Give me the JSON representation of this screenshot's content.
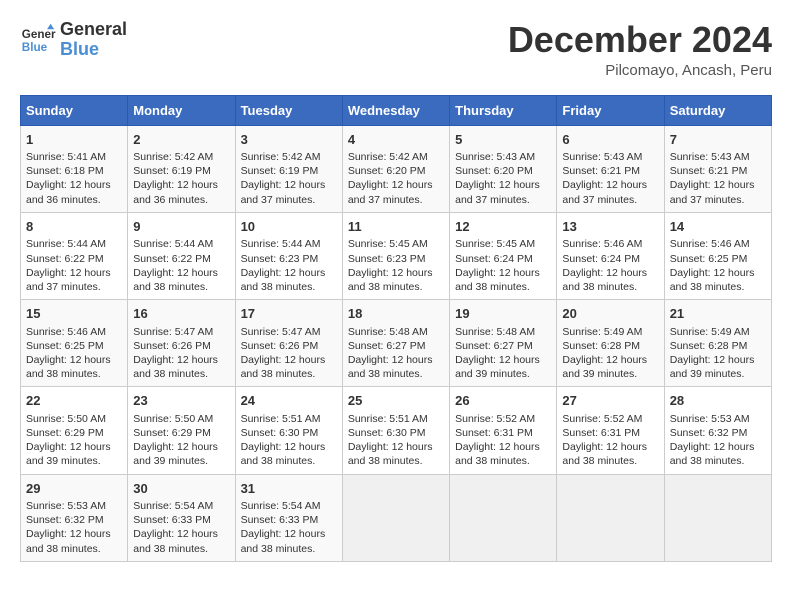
{
  "header": {
    "logo_line1": "General",
    "logo_line2": "Blue",
    "title": "December 2024",
    "subtitle": "Pilcomayo, Ancash, Peru"
  },
  "calendar": {
    "days_of_week": [
      "Sunday",
      "Monday",
      "Tuesday",
      "Wednesday",
      "Thursday",
      "Friday",
      "Saturday"
    ],
    "weeks": [
      [
        {
          "day": "",
          "info": ""
        },
        {
          "day": "2",
          "info": "Sunrise: 5:42 AM\nSunset: 6:19 PM\nDaylight: 12 hours\nand 36 minutes."
        },
        {
          "day": "3",
          "info": "Sunrise: 5:42 AM\nSunset: 6:19 PM\nDaylight: 12 hours\nand 37 minutes."
        },
        {
          "day": "4",
          "info": "Sunrise: 5:42 AM\nSunset: 6:20 PM\nDaylight: 12 hours\nand 37 minutes."
        },
        {
          "day": "5",
          "info": "Sunrise: 5:43 AM\nSunset: 6:20 PM\nDaylight: 12 hours\nand 37 minutes."
        },
        {
          "day": "6",
          "info": "Sunrise: 5:43 AM\nSunset: 6:21 PM\nDaylight: 12 hours\nand 37 minutes."
        },
        {
          "day": "7",
          "info": "Sunrise: 5:43 AM\nSunset: 6:21 PM\nDaylight: 12 hours\nand 37 minutes."
        }
      ],
      [
        {
          "day": "1",
          "info": "Sunrise: 5:41 AM\nSunset: 6:18 PM\nDaylight: 12 hours\nand 36 minutes."
        },
        {
          "day": "",
          "info": ""
        },
        {
          "day": "",
          "info": ""
        },
        {
          "day": "",
          "info": ""
        },
        {
          "day": "",
          "info": ""
        },
        {
          "day": "",
          "info": ""
        },
        {
          "day": "",
          "info": ""
        }
      ],
      [
        {
          "day": "8",
          "info": "Sunrise: 5:44 AM\nSunset: 6:22 PM\nDaylight: 12 hours\nand 37 minutes."
        },
        {
          "day": "9",
          "info": "Sunrise: 5:44 AM\nSunset: 6:22 PM\nDaylight: 12 hours\nand 38 minutes."
        },
        {
          "day": "10",
          "info": "Sunrise: 5:44 AM\nSunset: 6:23 PM\nDaylight: 12 hours\nand 38 minutes."
        },
        {
          "day": "11",
          "info": "Sunrise: 5:45 AM\nSunset: 6:23 PM\nDaylight: 12 hours\nand 38 minutes."
        },
        {
          "day": "12",
          "info": "Sunrise: 5:45 AM\nSunset: 6:24 PM\nDaylight: 12 hours\nand 38 minutes."
        },
        {
          "day": "13",
          "info": "Sunrise: 5:46 AM\nSunset: 6:24 PM\nDaylight: 12 hours\nand 38 minutes."
        },
        {
          "day": "14",
          "info": "Sunrise: 5:46 AM\nSunset: 6:25 PM\nDaylight: 12 hours\nand 38 minutes."
        }
      ],
      [
        {
          "day": "15",
          "info": "Sunrise: 5:46 AM\nSunset: 6:25 PM\nDaylight: 12 hours\nand 38 minutes."
        },
        {
          "day": "16",
          "info": "Sunrise: 5:47 AM\nSunset: 6:26 PM\nDaylight: 12 hours\nand 38 minutes."
        },
        {
          "day": "17",
          "info": "Sunrise: 5:47 AM\nSunset: 6:26 PM\nDaylight: 12 hours\nand 38 minutes."
        },
        {
          "day": "18",
          "info": "Sunrise: 5:48 AM\nSunset: 6:27 PM\nDaylight: 12 hours\nand 38 minutes."
        },
        {
          "day": "19",
          "info": "Sunrise: 5:48 AM\nSunset: 6:27 PM\nDaylight: 12 hours\nand 39 minutes."
        },
        {
          "day": "20",
          "info": "Sunrise: 5:49 AM\nSunset: 6:28 PM\nDaylight: 12 hours\nand 39 minutes."
        },
        {
          "day": "21",
          "info": "Sunrise: 5:49 AM\nSunset: 6:28 PM\nDaylight: 12 hours\nand 39 minutes."
        }
      ],
      [
        {
          "day": "22",
          "info": "Sunrise: 5:50 AM\nSunset: 6:29 PM\nDaylight: 12 hours\nand 39 minutes."
        },
        {
          "day": "23",
          "info": "Sunrise: 5:50 AM\nSunset: 6:29 PM\nDaylight: 12 hours\nand 39 minutes."
        },
        {
          "day": "24",
          "info": "Sunrise: 5:51 AM\nSunset: 6:30 PM\nDaylight: 12 hours\nand 38 minutes."
        },
        {
          "day": "25",
          "info": "Sunrise: 5:51 AM\nSunset: 6:30 PM\nDaylight: 12 hours\nand 38 minutes."
        },
        {
          "day": "26",
          "info": "Sunrise: 5:52 AM\nSunset: 6:31 PM\nDaylight: 12 hours\nand 38 minutes."
        },
        {
          "day": "27",
          "info": "Sunrise: 5:52 AM\nSunset: 6:31 PM\nDaylight: 12 hours\nand 38 minutes."
        },
        {
          "day": "28",
          "info": "Sunrise: 5:53 AM\nSunset: 6:32 PM\nDaylight: 12 hours\nand 38 minutes."
        }
      ],
      [
        {
          "day": "29",
          "info": "Sunrise: 5:53 AM\nSunset: 6:32 PM\nDaylight: 12 hours\nand 38 minutes."
        },
        {
          "day": "30",
          "info": "Sunrise: 5:54 AM\nSunset: 6:33 PM\nDaylight: 12 hours\nand 38 minutes."
        },
        {
          "day": "31",
          "info": "Sunrise: 5:54 AM\nSunset: 6:33 PM\nDaylight: 12 hours\nand 38 minutes."
        },
        {
          "day": "",
          "info": ""
        },
        {
          "day": "",
          "info": ""
        },
        {
          "day": "",
          "info": ""
        },
        {
          "day": "",
          "info": ""
        }
      ]
    ]
  }
}
